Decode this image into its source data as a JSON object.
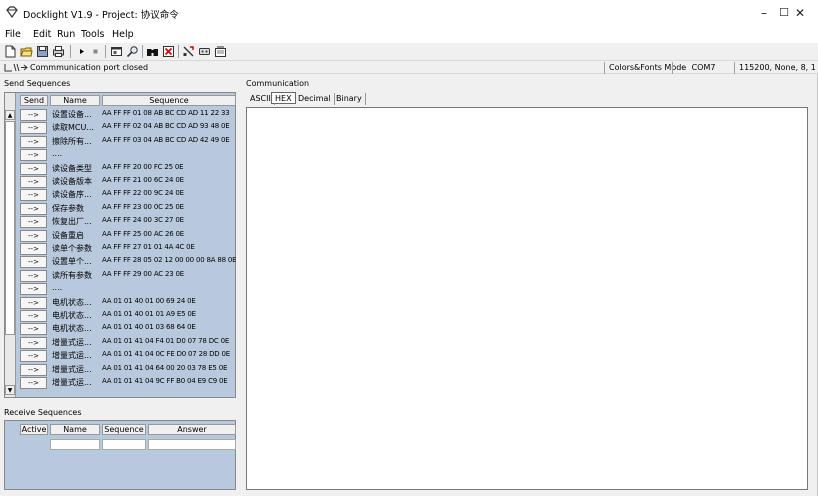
{
  "window": {
    "title": "Docklight V1.9 - Project: 协议命令",
    "minimize": "–",
    "maximize": "☐",
    "close": "✕"
  },
  "menu": [
    "File",
    "Edit",
    "Run",
    "Tools",
    "Help"
  ],
  "status": {
    "message": "Commmunication port closed",
    "mode": "Colors&Fonts Mode",
    "port": "COM7",
    "settings": "115200, None, 8, 1"
  },
  "send": {
    "label": "Send Sequences",
    "headers": {
      "send": "Send",
      "name": "Name",
      "sequence": "Sequence"
    },
    "button_label": "-->",
    "rows": [
      {
        "name": "设置设备...",
        "sequence": "AA FF FF 01 08 AB BC CD AD 11 22 33"
      },
      {
        "name": "读取MCU...",
        "sequence": "AA FF FF 02 04 AB BC CD AD 93 48 0E"
      },
      {
        "name": "擦除所有...",
        "sequence": "AA FF FF 03 04 AB BC CD AD 42 49 0E"
      },
      {
        "name": "....",
        "sequence": ""
      },
      {
        "name": "读设备类型",
        "sequence": "AA FF FF 20 00 FC 25 0E"
      },
      {
        "name": "读设备版本",
        "sequence": "AA FF FF 21 00 6C 24 0E"
      },
      {
        "name": "读设备序...",
        "sequence": "AA FF FF 22 00 9C 24 0E"
      },
      {
        "name": "保存参数",
        "sequence": "AA FF FF 23 00 0C 25 0E"
      },
      {
        "name": "恢复出厂...",
        "sequence": "AA FF FF 24 00 3C 27 0E"
      },
      {
        "name": "设备重启",
        "sequence": "AA FF FF 25 00 AC 26 0E"
      },
      {
        "name": "读单个参数",
        "sequence": "AA FF FF 27 01 01 4A 4C 0E"
      },
      {
        "name": "设置单个...",
        "sequence": "AA FF FF 28 05 02 12 00 00 00 8A 88 0E"
      },
      {
        "name": "读所有参数",
        "sequence": "AA FF FF 29 00 AC 23 0E"
      },
      {
        "name": "....",
        "sequence": ""
      },
      {
        "name": "电机状态...",
        "sequence": "AA 01 01 40 01 00 69 24 0E"
      },
      {
        "name": "电机状态...",
        "sequence": "AA 01 01 40 01 01 A9 E5 0E"
      },
      {
        "name": "电机状态...",
        "sequence": "AA 01 01 40 01 03 68 64 0E"
      },
      {
        "name": "增量式运...",
        "sequence": "AA 01 01 41 04 F4 01 D0 07 78 DC 0E"
      },
      {
        "name": "增量式运...",
        "sequence": "AA 01 01 41 04 0C FE D0 07 28 DD 0E"
      },
      {
        "name": "增量式运...",
        "sequence": "AA 01 01 41 04 64 00 20 03 78 E5 0E"
      },
      {
        "name": "增量式运...",
        "sequence": "AA 01 01 41 04 9C FF B0 04 E9 C9 0E"
      }
    ]
  },
  "receive": {
    "label": "Receive Sequences",
    "headers": {
      "active": "Active",
      "name": "Name",
      "sequence": "Sequence",
      "answer": "Answer"
    }
  },
  "communication": {
    "label": "Communication",
    "tabs": [
      "ASCII",
      "HEX",
      "Decimal",
      "Binary"
    ],
    "active_tab": "HEX"
  },
  "colors": {
    "panel_bg": "#b9c9dd"
  }
}
